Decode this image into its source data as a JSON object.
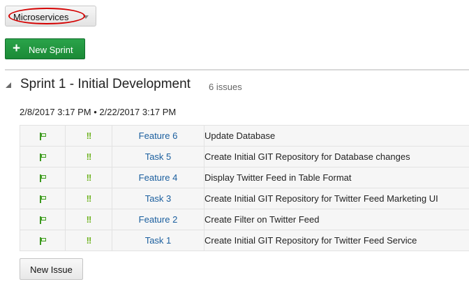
{
  "project_selector": {
    "label": "Microservices"
  },
  "new_sprint_button": {
    "label": "New Sprint"
  },
  "sprint": {
    "title": "Sprint 1 - Initial Development",
    "issue_count": "6 issues",
    "dates": "2/8/2017 3:17 PM • 2/22/2017 3:17 PM"
  },
  "issues": [
    {
      "type_icon": "flag-icon",
      "priority_icon": "!!",
      "key": "Feature 6",
      "summary": "Update Database"
    },
    {
      "type_icon": "flag-icon",
      "priority_icon": "!!",
      "key": "Task 5",
      "summary": "Create Initial GIT Repository for Database changes"
    },
    {
      "type_icon": "flag-icon",
      "priority_icon": "!!",
      "key": "Feature 4",
      "summary": "Display Twitter Feed in Table Format"
    },
    {
      "type_icon": "flag-icon",
      "priority_icon": "!!",
      "key": "Task 3",
      "summary": "Create Initial GIT Repository for Twitter Feed Marketing UI"
    },
    {
      "type_icon": "flag-icon",
      "priority_icon": "!!",
      "key": "Feature 2",
      "summary": "Create Filter on Twitter Feed"
    },
    {
      "type_icon": "flag-icon",
      "priority_icon": "!!",
      "key": "Task 1",
      "summary": "Create Initial GIT Repository for Twitter Feed Service"
    }
  ],
  "new_issue_button": {
    "label": "New Issue"
  },
  "colors": {
    "primary_button": "#1b8a36",
    "link": "#1a5e9e",
    "flag": "#3d9a20",
    "priority": "#6fb321",
    "highlight_ellipse": "#d40000"
  }
}
